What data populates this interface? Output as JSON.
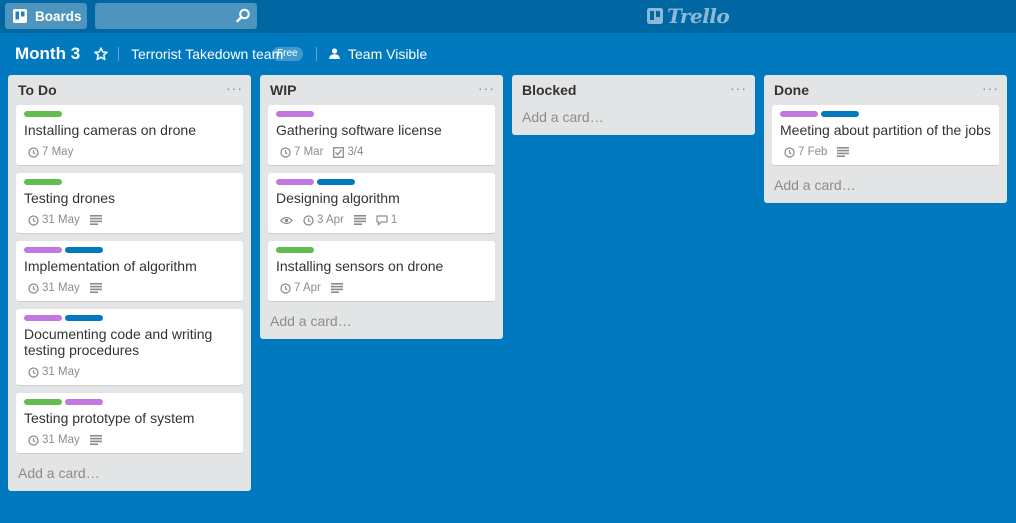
{
  "topbar": {
    "boards_label": "Boards",
    "search_placeholder": "",
    "logo_text": "Trello"
  },
  "board": {
    "title": "Month 3",
    "team": "Terrorist Takedown team",
    "plan_badge": "Free",
    "visibility": "Team Visible"
  },
  "colors": {
    "green": "#61bd4f",
    "purple": "#c377e0",
    "blue": "#0079bf"
  },
  "add_card_label": "Add a card…",
  "lists": [
    {
      "title": "To Do",
      "cards": [
        {
          "labels": [
            "green"
          ],
          "title": "Installing cameras on drone",
          "due": "7 May",
          "description": false
        },
        {
          "labels": [
            "green"
          ],
          "title": "Testing drones",
          "due": "31 May",
          "description": true
        },
        {
          "labels": [
            "purple",
            "blue"
          ],
          "title": "Implementation of algorithm",
          "due": "31 May",
          "description": true
        },
        {
          "labels": [
            "purple",
            "blue"
          ],
          "title": "Documenting code and writing testing procedures",
          "due": "31 May",
          "description": false
        },
        {
          "labels": [
            "green",
            "purple"
          ],
          "title": "Testing prototype of system",
          "due": "31 May",
          "description": true
        }
      ]
    },
    {
      "title": "WIP",
      "cards": [
        {
          "labels": [
            "purple"
          ],
          "title": "Gathering software license",
          "due": "7 Mar",
          "checklist": "3/4",
          "description": false
        },
        {
          "labels": [
            "purple",
            "blue"
          ],
          "title": "Designing algorithm",
          "watching": true,
          "due": "3 Apr",
          "description": true,
          "comments": "1"
        },
        {
          "labels": [
            "green"
          ],
          "title": "Installing sensors on drone",
          "due": "7 Apr",
          "description": true
        }
      ]
    },
    {
      "title": "Blocked",
      "cards": []
    },
    {
      "title": "Done",
      "cards": [
        {
          "labels": [
            "purple",
            "blue"
          ],
          "title": "Meeting about partition of the jobs",
          "due": "7 Feb",
          "description": true
        }
      ]
    }
  ]
}
